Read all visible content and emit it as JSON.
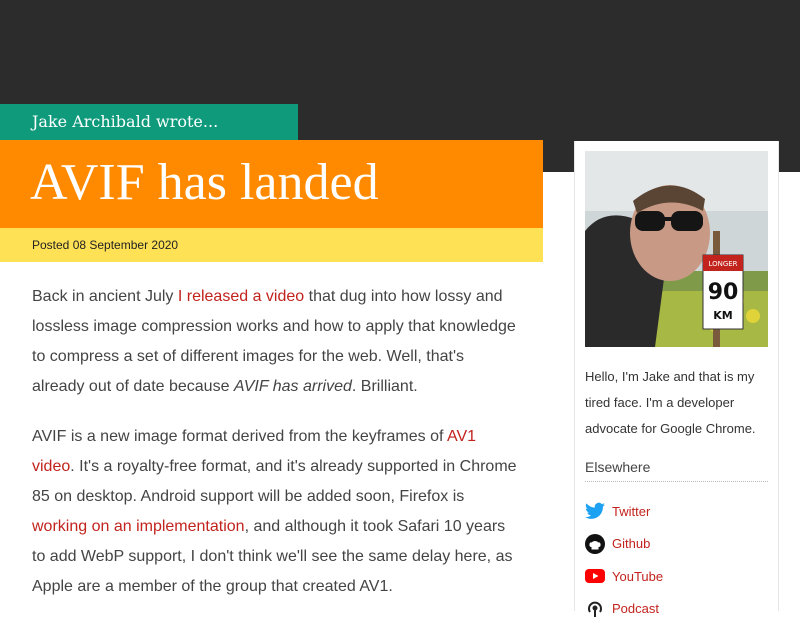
{
  "header": {
    "author_line": "Jake Archibald wrote...",
    "title": "AVIF has landed",
    "posted": "Posted 08 September 2020"
  },
  "article": {
    "p1": {
      "t1": "Back in ancient July ",
      "link1": "I released a video",
      "t2": " that dug into how lossy and lossless image compression works and how to apply that knowledge to compress a set of different images for the web. Well, that's already out of date because ",
      "em1": "AVIF has arrived",
      "t3": ". Brilliant."
    },
    "p2": {
      "t1": "AVIF is a new image format derived from the keyframes of ",
      "link1": "AV1 video",
      "t2": ". It's a royalty-free format, and it's already supported in Chrome 85 on desktop. Android support will be added soon, Firefox is ",
      "link2": "working on an implementation",
      "t3": ", and although it took Safari 10 years to add WebP support, I don't think we'll see the same delay here, as Apple are a member of the group that created AV1."
    }
  },
  "sidebar": {
    "photo_sign": {
      "top_text": "LONGER",
      "number": "90",
      "unit": "KM"
    },
    "bio": "Hello, I'm Jake and that is my tired face. I'm a developer advocate for Google Chrome.",
    "elsewhere_heading": "Elsewhere",
    "links": [
      {
        "label": "Twitter",
        "icon": "twitter-icon"
      },
      {
        "label": "Github",
        "icon": "github-icon"
      },
      {
        "label": "YouTube",
        "icon": "youtube-icon"
      },
      {
        "label": "Podcast",
        "icon": "podcast-icon"
      }
    ]
  },
  "colors": {
    "topbar": "#2c2c2c",
    "author_tab": "#0f9a7c",
    "title_bar": "#ff8a00",
    "date_bar": "#ffe156",
    "link": "#c2231d"
  }
}
